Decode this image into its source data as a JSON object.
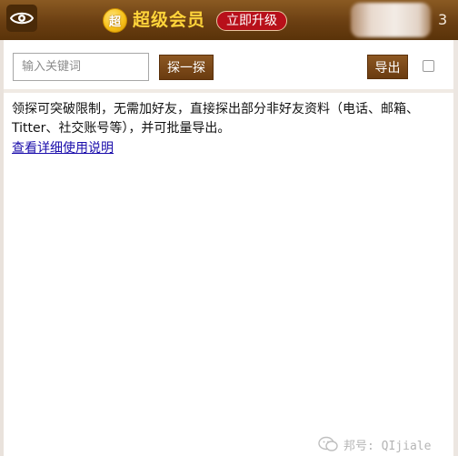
{
  "header": {
    "vip_badge": "超",
    "vip_title": "超级会员",
    "upgrade_label": "立即升级",
    "count": "3",
    "eye_icon": "eye-icon"
  },
  "toolbar": {
    "search_placeholder": "输入关键词",
    "search_value": "",
    "explore_label": "探一探",
    "export_label": "导出",
    "select_all_checked": false
  },
  "content": {
    "description": "领探可突破限制，无需加好友，直接探出部分非好友资料（电话、邮箱、Titter、社交账号等），并可批量导出。",
    "help_link": "查看详细使用说明"
  },
  "watermark": {
    "text": "邦号: QIjiale"
  },
  "colors": {
    "header_brown": "#6b3f12",
    "button_brown": "#7a4718",
    "vip_gold": "#ffd43a",
    "upgrade_red": "#b8101a",
    "link_blue": "#1a0dab"
  }
}
